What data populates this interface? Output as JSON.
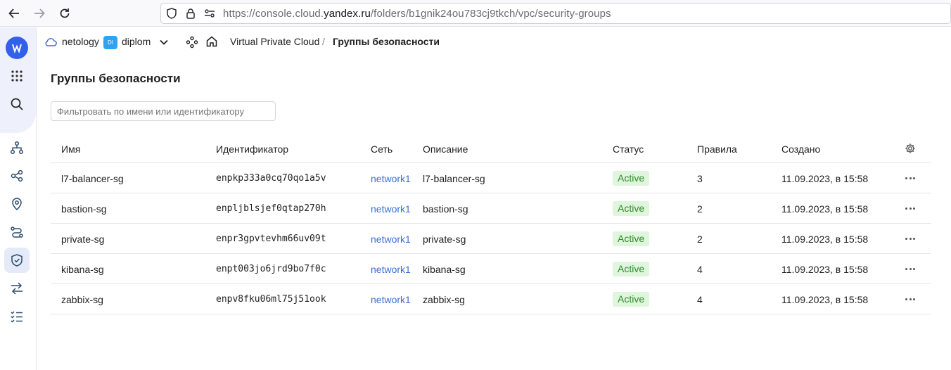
{
  "browser": {
    "url_prefix": "https://console.cloud.",
    "url_domain": "yandex.ru",
    "url_path": "/folders/b1gnik24ou783cj9tkch/vpc/security-groups"
  },
  "header": {
    "cloud_name": "netology",
    "folder_badge": "DI",
    "folder_name": "diplom",
    "service": "Virtual Private Cloud",
    "separator": "/",
    "current": "Группы безопасности"
  },
  "page": {
    "title": "Группы безопасности",
    "filter_placeholder": "Фильтровать по имени или идентификатору"
  },
  "table": {
    "columns": {
      "name": "Имя",
      "id": "Идентификатор",
      "network": "Сеть",
      "description": "Описание",
      "status": "Статус",
      "rules": "Правила",
      "created": "Создано"
    },
    "rows": [
      {
        "name": "l7-balancer-sg",
        "id": "enpkp333a0cq70qo1a5v",
        "network": "network1",
        "description": "l7-balancer-sg",
        "status": "Active",
        "rules": "3",
        "created": "11.09.2023, в 15:58"
      },
      {
        "name": "bastion-sg",
        "id": "enpljblsjef0qtap270h",
        "network": "network1",
        "description": "bastion-sg",
        "status": "Active",
        "rules": "2",
        "created": "11.09.2023, в 15:58"
      },
      {
        "name": "private-sg",
        "id": "enpr3gpvtevhm66uv09t",
        "network": "network1",
        "description": "private-sg",
        "status": "Active",
        "rules": "2",
        "created": "11.09.2023, в 15:58"
      },
      {
        "name": "kibana-sg",
        "id": "enpt003jo6jrd9bo7f0c",
        "network": "network1",
        "description": "kibana-sg",
        "status": "Active",
        "rules": "4",
        "created": "11.09.2023, в 15:58"
      },
      {
        "name": "zabbix-sg",
        "id": "enpv8fku06ml75j51ook",
        "network": "network1",
        "description": "zabbix-sg",
        "status": "Active",
        "rules": "4",
        "created": "11.09.2023, в 15:58"
      }
    ]
  },
  "colors": {
    "accent": "#3360e8",
    "link": "#3c6ed6",
    "status_bg": "#dff5dc",
    "status_text": "#2e8a2e"
  }
}
